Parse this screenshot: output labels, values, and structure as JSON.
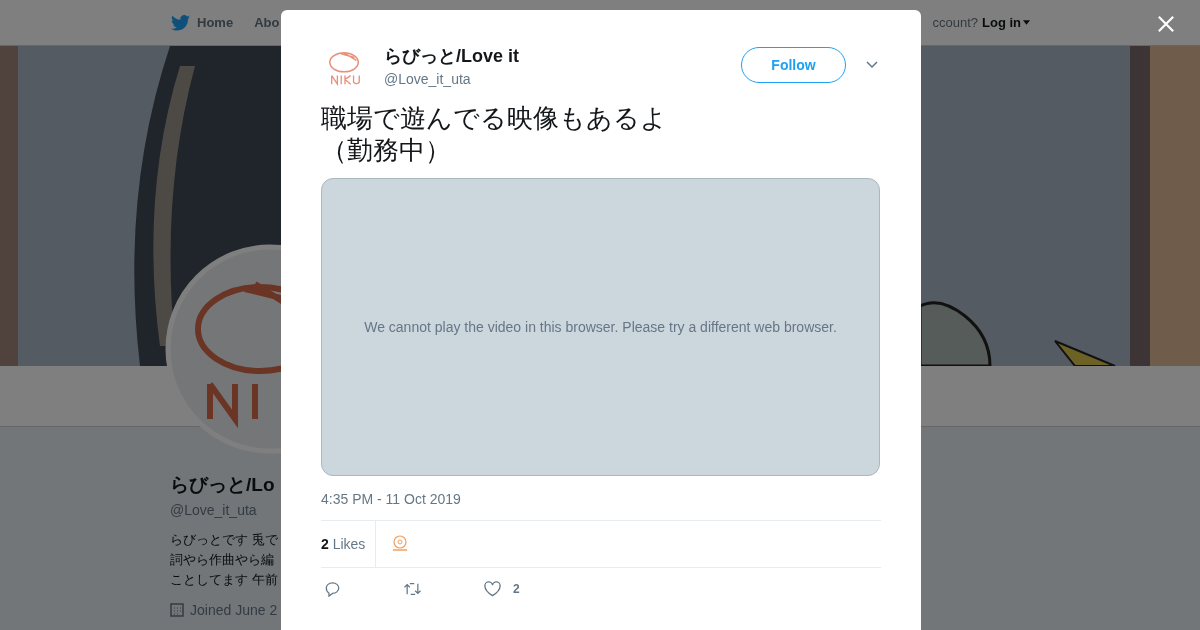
{
  "nav": {
    "items": [
      {
        "label": "Home"
      },
      {
        "label": "Abo"
      }
    ],
    "login_prompt": "ccount?",
    "login": "Log in"
  },
  "profile": {
    "name": "らびっと/Lo",
    "handle": "@Love_it_uta",
    "bio": "らびっとです 兎で詞やら作曲やら編ことしてます 午前",
    "joined": "Joined June 2"
  },
  "tweet": {
    "name": "らびっと/Love it",
    "handle": "@Love_it_uta",
    "follow": "Follow",
    "text": "職場で遊んでる映像もあるよ（勤務中）",
    "video_message": "We cannot play the video in this browser. Please try a different web browser.",
    "timestamp": "4:35 PM - 11 Oct 2019",
    "likes_count": "2",
    "likes_label": "Likes",
    "like_count": "2"
  }
}
